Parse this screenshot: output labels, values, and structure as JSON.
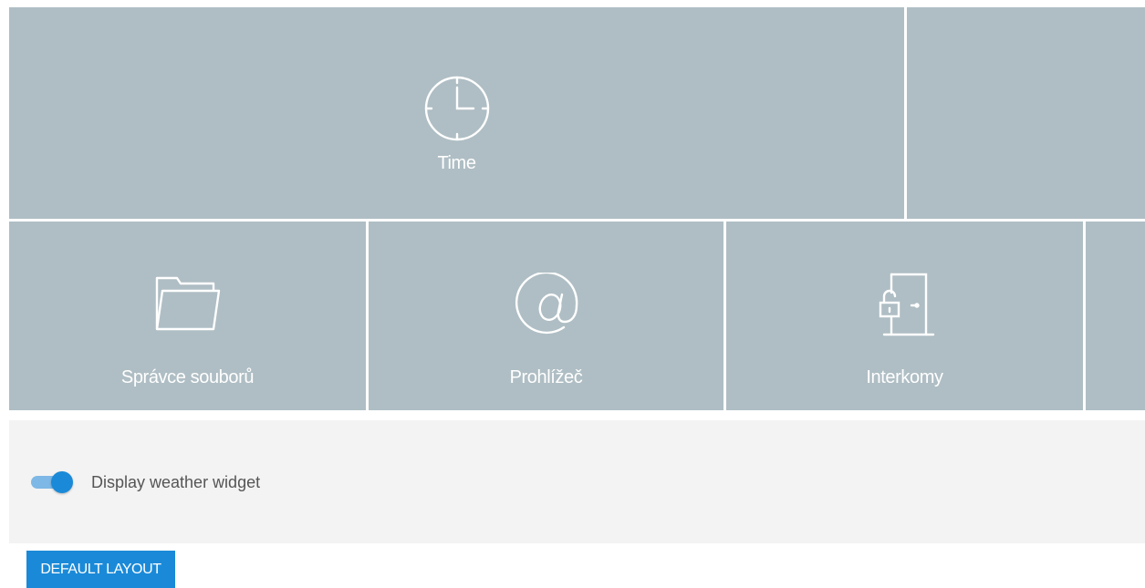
{
  "tiles": {
    "time": {
      "label": "Time",
      "icon": "clock-icon"
    },
    "files": {
      "label": "Správce souborů",
      "icon": "folder-icon"
    },
    "browser": {
      "label": "Prohlížeč",
      "icon": "at-sign-icon"
    },
    "intercom": {
      "label": "Interkomy",
      "icon": "door-lock-icon"
    }
  },
  "settings": {
    "weather_toggle": {
      "label": "Display weather widget",
      "checked": true
    }
  },
  "actions": {
    "default_layout_label": "DEFAULT LAYOUT"
  },
  "colors": {
    "tile_bg": "#afbec4",
    "panel_bg": "#f3f3f3",
    "accent": "#1a8ad8",
    "toggle_track": "#7db8e6"
  }
}
